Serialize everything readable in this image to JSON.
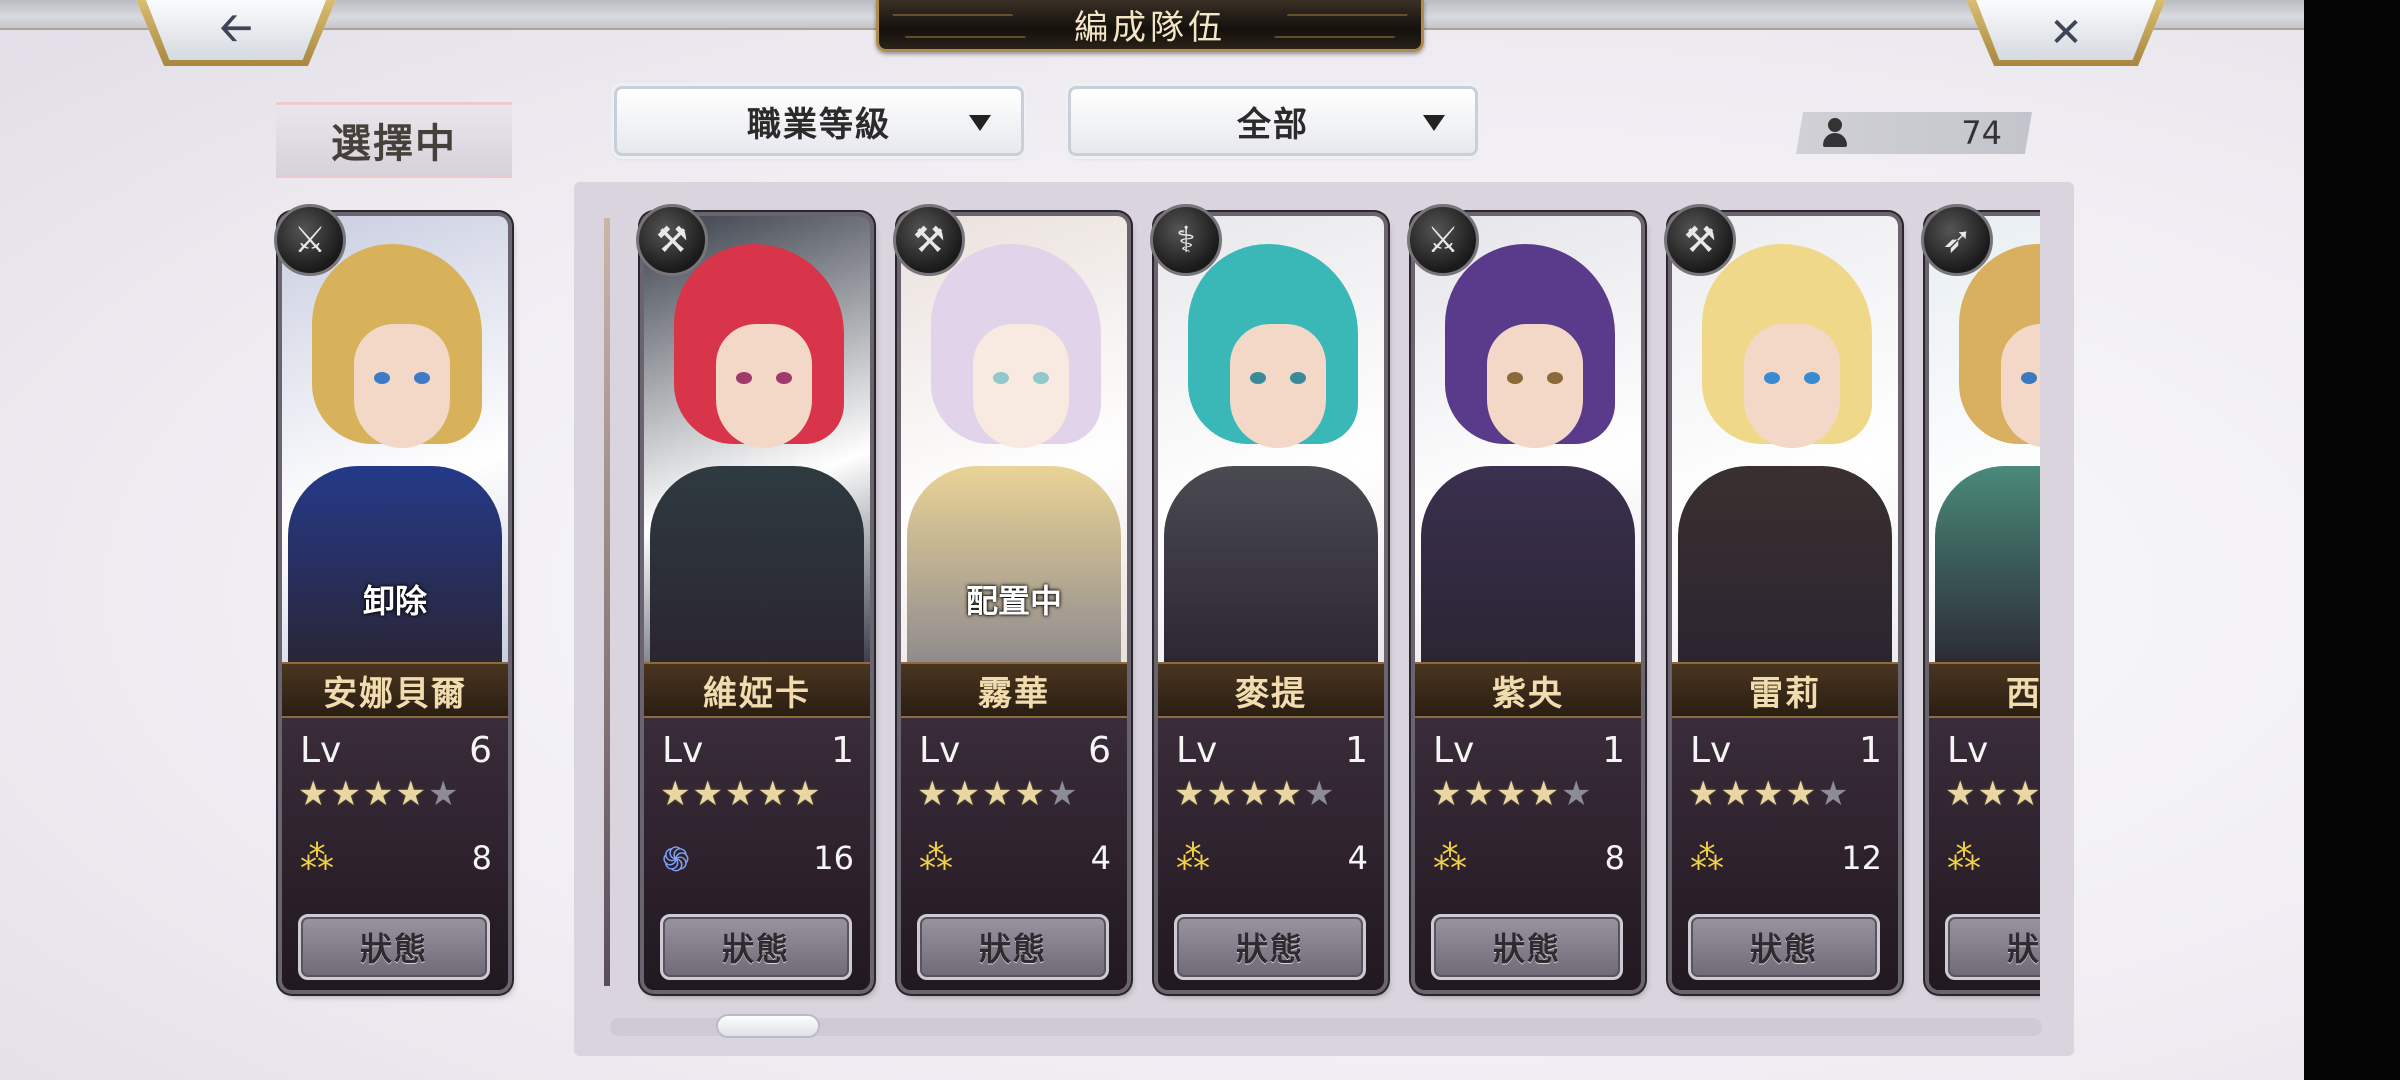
{
  "header": {
    "title": "編成隊伍",
    "back_icon": "left-arrow-icon",
    "close_icon": "close-icon"
  },
  "selected_label": "選擇中",
  "filters": {
    "class_level": "職業等級",
    "all": "全部"
  },
  "unit_count": "74",
  "selected_card": {
    "name": "安娜貝爾",
    "lv_label": "Lv",
    "level": "6",
    "stars": 4,
    "max_stars": 5,
    "resource_icon": "wing-icon",
    "resource_value": "8",
    "overlay_label": "卸除",
    "status_label": "狀態",
    "class_icon": "sword-icon",
    "colors": {
      "bg": "#c9cde0",
      "hair": "#d8b25a",
      "outfit": "#243a8a",
      "eye": "#3d7bc8"
    }
  },
  "cards": [
    {
      "name": "維婭卡",
      "lv_label": "Lv",
      "level": "1",
      "stars": 5,
      "max_stars": 5,
      "resource_icon": "swirl-icon",
      "resource_value": "16",
      "status_label": "狀態",
      "overlay_label": "",
      "class_icon": "hammer-icon",
      "colors": {
        "bg": "#3a3f4a",
        "hair": "#d8344a",
        "outfit": "#2e3a40",
        "eye": "#a03a6a"
      }
    },
    {
      "name": "霧華",
      "lv_label": "Lv",
      "level": "6",
      "stars": 4,
      "max_stars": 5,
      "resource_icon": "wing-icon",
      "resource_value": "4",
      "status_label": "狀態",
      "overlay_label": "配置中",
      "class_icon": "hammer-icon",
      "colors": {
        "bg": "#d8c8c0",
        "hair": "#c8b0d8",
        "outfit": "#d8b040",
        "eye": "#3a9aa0"
      }
    },
    {
      "name": "麥提",
      "lv_label": "Lv",
      "level": "1",
      "stars": 4,
      "max_stars": 5,
      "resource_icon": "wing-icon",
      "resource_value": "4",
      "status_label": "狀態",
      "overlay_label": "",
      "class_icon": "staff-icon",
      "colors": {
        "bg": "#e8e8ec",
        "hair": "#3ab8b8",
        "outfit": "#4a4a52",
        "eye": "#3a8a9a"
      }
    },
    {
      "name": "紫央",
      "lv_label": "Lv",
      "level": "1",
      "stars": 4,
      "max_stars": 5,
      "resource_icon": "wing-icon",
      "resource_value": "8",
      "status_label": "狀態",
      "overlay_label": "",
      "class_icon": "sword-icon",
      "colors": {
        "bg": "#e4e4ea",
        "hair": "#5a3a8a",
        "outfit": "#3a3050",
        "eye": "#8a6a3a"
      }
    },
    {
      "name": "雷莉",
      "lv_label": "Lv",
      "level": "1",
      "stars": 4,
      "max_stars": 5,
      "resource_icon": "wing-icon",
      "resource_value": "12",
      "status_label": "狀態",
      "overlay_label": "",
      "class_icon": "axe-icon",
      "colors": {
        "bg": "#ececf0",
        "hair": "#f0d88a",
        "outfit": "#3a3030",
        "eye": "#3a8ad0"
      }
    },
    {
      "name": "西嫁",
      "lv_label": "Lv",
      "level": "",
      "stars": 3,
      "max_stars": 5,
      "resource_icon": "wing-icon",
      "resource_value": "",
      "status_label": "狀態",
      "overlay_label": "",
      "class_icon": "bow-icon",
      "colors": {
        "bg": "#e8eef2",
        "hair": "#d8b060",
        "outfit": "#4a8a7a",
        "eye": "#3a7ac0"
      }
    }
  ],
  "scroll_position": 0.08
}
